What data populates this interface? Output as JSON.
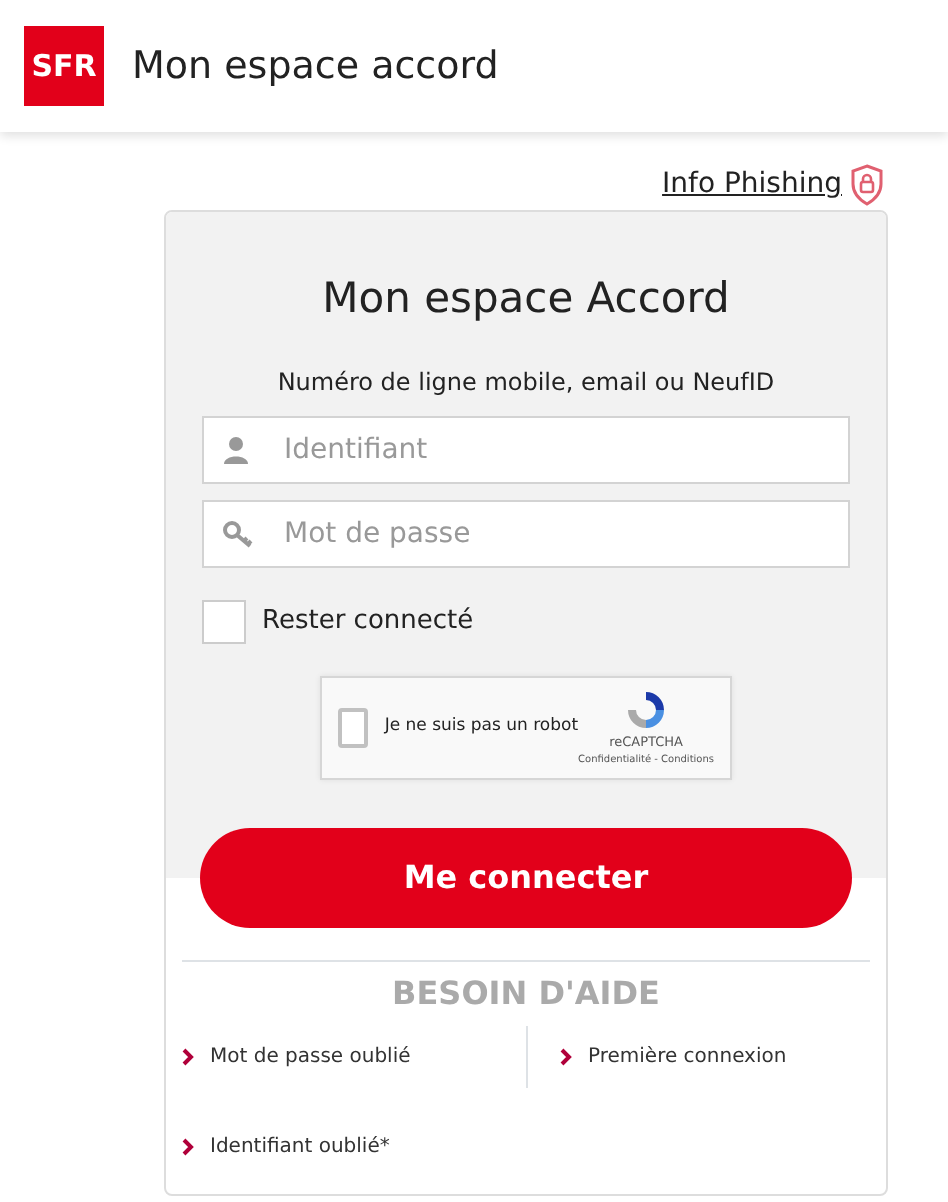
{
  "header": {
    "logo": "SFR",
    "title": "Mon espace accord"
  },
  "info_link": "Info Phishing",
  "login": {
    "title": "Mon espace Accord",
    "hint": "Numéro de ligne mobile, email ou NeufID",
    "fields": [
      {
        "kind": "user",
        "placeholder": "Identifiant"
      },
      {
        "kind": "key",
        "placeholder": "Mot de passe"
      }
    ],
    "remember": {
      "label": "Rester connecté",
      "checked": false
    },
    "captcha": {
      "label": "Je ne suis pas un robot",
      "checked": false,
      "brand": "reCAPTCHA",
      "terms": "Confidentialité - Conditions"
    },
    "submit": "Me connecter"
  },
  "help": {
    "title": "BESOIN D'AIDE",
    "links": [
      "Mot de passe oublié",
      "Première connexion",
      "Identifiant oublié*"
    ]
  }
}
